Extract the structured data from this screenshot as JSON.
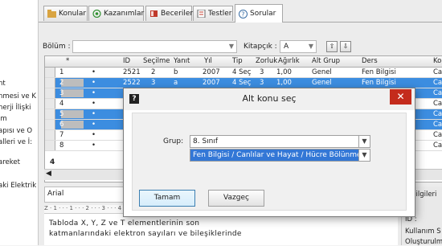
{
  "left_tree": [
    "nt",
    "nmesi ve K",
    "nerji İlişki",
    "im",
    "apısı ve O",
    "alleri ve İ:",
    "areket",
    "aki Elektrik"
  ],
  "tabs": [
    {
      "label": "Konular",
      "icon": "folder-icon"
    },
    {
      "label": "Kazanımlar",
      "icon": "target-icon"
    },
    {
      "label": "Beceriler",
      "icon": "book-icon"
    },
    {
      "label": "Testler",
      "icon": "test-icon"
    },
    {
      "label": "Sorular",
      "icon": "question-icon"
    }
  ],
  "filters": {
    "bolum_label": "Bölüm :",
    "bolum_value": "",
    "kitapcik_label": "Kitapçık :",
    "kitapcik_value": "A",
    "up_label": "⇧",
    "down_label": "⇩"
  },
  "grid": {
    "columns": [
      "*",
      "ID",
      "Seçilme",
      "Yanıt",
      "Yıl",
      "Tip",
      "Zorluk",
      "Ağırlık",
      "Alt Grup",
      "Ders",
      "Ko"
    ],
    "rows": [
      {
        "n": "1",
        "id": "2521",
        "secilme": "2",
        "yanit": "b",
        "yil": "2007",
        "tip": "4 Seç",
        "zorluk": "3",
        "agirlik": "1,00",
        "altgrup": "Genel",
        "ders": "Fen Bilgisi",
        "ko": "Ca",
        "selected": false
      },
      {
        "n": "2",
        "id": "2522",
        "secilme": "3",
        "yanit": "a",
        "yil": "2007",
        "tip": "4 Seç",
        "zorluk": "3",
        "agirlik": "1,00",
        "altgrup": "Genel",
        "ders": "Fen Bilgisi",
        "ko": "Ca",
        "selected": true
      },
      {
        "n": "3",
        "id": "25",
        "secilme": "",
        "yanit": "",
        "yil": "",
        "tip": "",
        "zorluk": "",
        "agirlik": "",
        "altgrup": "",
        "ders": "",
        "ko": "Ca",
        "selected": true
      },
      {
        "n": "4",
        "id": "25",
        "secilme": "",
        "yanit": "",
        "yil": "",
        "tip": "",
        "zorluk": "",
        "agirlik": "",
        "altgrup": "",
        "ders": "",
        "ko": "Ca",
        "selected": false
      },
      {
        "n": "5",
        "id": "25",
        "secilme": "",
        "yanit": "",
        "yil": "",
        "tip": "",
        "zorluk": "",
        "agirlik": "",
        "altgrup": "",
        "ders": "",
        "ko": "Ca",
        "selected": true
      },
      {
        "n": "6",
        "id": "25",
        "secilme": "",
        "yanit": "",
        "yil": "",
        "tip": "",
        "zorluk": "",
        "agirlik": "",
        "altgrup": "",
        "ders": "",
        "ko": "Ca",
        "selected": true
      },
      {
        "n": "7",
        "id": "25",
        "secilme": "",
        "yanit": "",
        "yil": "",
        "tip": "",
        "zorluk": "",
        "agirlik": "",
        "altgrup": "",
        "ders": "",
        "ko": "Ca",
        "selected": false
      },
      {
        "n": "8",
        "id": "25",
        "secilme": "",
        "yanit": "",
        "yil": "",
        "tip": "",
        "zorluk": "",
        "agirlik": "",
        "altgrup": "",
        "ders": "",
        "ko": "Ca",
        "selected": false
      }
    ],
    "footer_count": "4"
  },
  "editor": {
    "font": "Arial",
    "ruler": "Z · 1 · · · 1 · · · 2 · · · 3 · · · 4 · · · 5 · · · 6 · · · 7 · · · 8 · · · 9 · · · 10 · · · 11",
    "text_line1": "Tabloda X, Y, Z ve T elementlerinin son",
    "text_line2": "katmanlarındaki elektron sayıları ve bileşiklerinde"
  },
  "side_panel": {
    "header": "u bilgileri",
    "id_label": "ID :",
    "kullanim": "Kullanım S",
    "olusturulma": "Oluşturulm"
  },
  "dialog": {
    "title": "Alt konu seç",
    "grup_label": "Grup:",
    "grup_value": "8. Sınıf",
    "konu_value": "Fen Bilgisi / Canlılar ve Hayat / Hücre Bölünmesi ve Ka",
    "ok_label": "Tamam",
    "cancel_label": "Vazgeç",
    "close_label": "✕",
    "question_glyph": "?"
  }
}
